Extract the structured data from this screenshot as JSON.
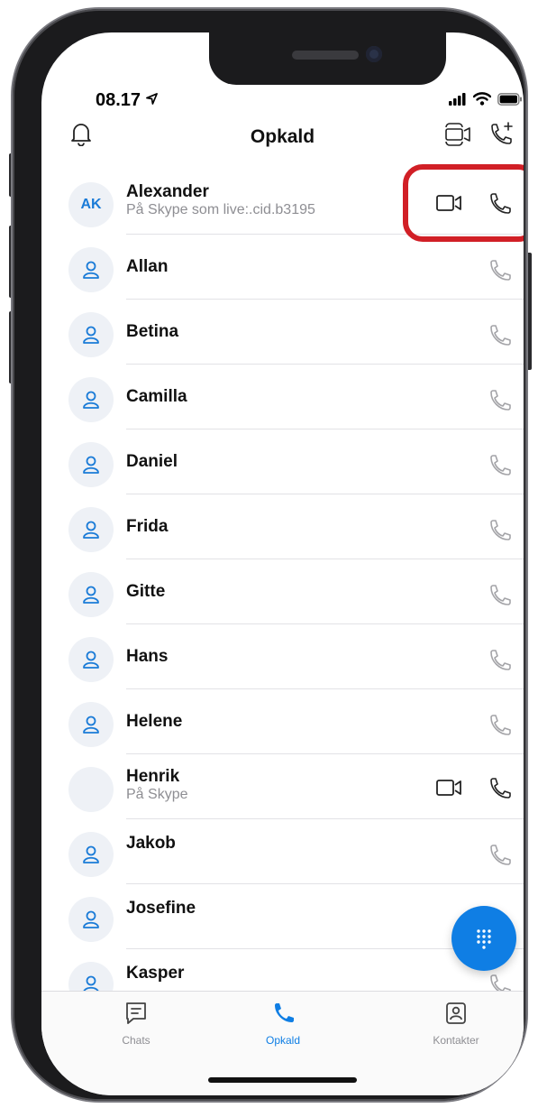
{
  "status": {
    "time": "08.17"
  },
  "header": {
    "title": "Opkald"
  },
  "contacts": [
    {
      "initials": "AK",
      "name": "Alexander",
      "subtitle": "På Skype som live:.cid.b3195",
      "video": true,
      "active": true
    },
    {
      "initials": "",
      "name": "Allan",
      "subtitle": "",
      "video": false,
      "active": false
    },
    {
      "initials": "",
      "name": "Betina",
      "subtitle": "",
      "video": false,
      "active": false
    },
    {
      "initials": "",
      "name": "Camilla",
      "subtitle": "",
      "video": false,
      "active": false
    },
    {
      "initials": "",
      "name": "Daniel",
      "subtitle": "",
      "video": false,
      "active": false
    },
    {
      "initials": "",
      "name": "Frida",
      "subtitle": "",
      "video": false,
      "active": false
    },
    {
      "initials": "",
      "name": "Gitte",
      "subtitle": "",
      "video": false,
      "active": false
    },
    {
      "initials": "",
      "name": "Hans",
      "subtitle": "",
      "video": false,
      "active": false
    },
    {
      "initials": "",
      "name": "Helene",
      "subtitle": "",
      "video": false,
      "active": false
    },
    {
      "initials": "",
      "name": "Henrik",
      "subtitle": "På Skype",
      "video": true,
      "active": true
    },
    {
      "initials": "",
      "name": "Jakob",
      "subtitle": "",
      "video": false,
      "active": false
    },
    {
      "initials": "",
      "name": "Josefine",
      "subtitle": "",
      "video": false,
      "active": false
    },
    {
      "initials": "",
      "name": "Kasper",
      "subtitle": "",
      "video": false,
      "active": false
    }
  ],
  "tabs": [
    {
      "label": "Chats",
      "icon": "chat-icon",
      "active": false
    },
    {
      "label": "Opkald",
      "icon": "phone-icon",
      "active": true
    },
    {
      "label": "Kontakter",
      "icon": "contacts-icon",
      "active": false
    }
  ],
  "colors": {
    "accent": "#0f7ee4",
    "highlight": "#d11f26",
    "inactive_icon": "#a4a4a8"
  }
}
